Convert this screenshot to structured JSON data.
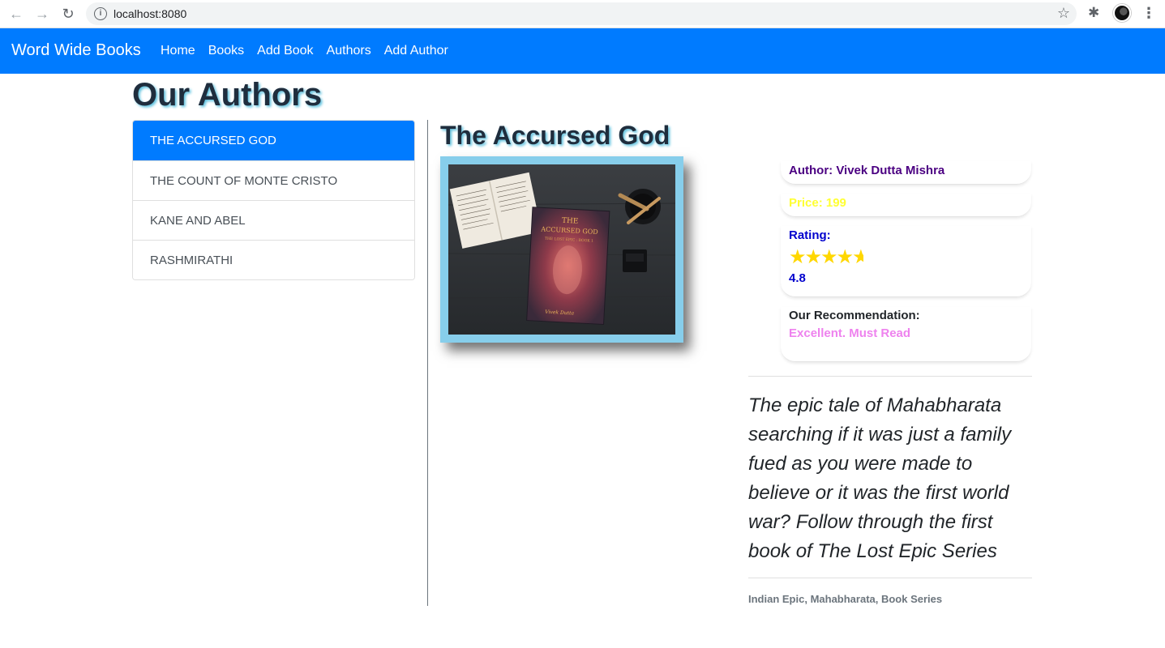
{
  "browser": {
    "url": "localhost:8080",
    "icons": [
      "back-icon",
      "forward-icon",
      "reload-icon",
      "info-icon",
      "star-icon",
      "extensions-icon",
      "profile-avatar",
      "menu-icon"
    ]
  },
  "navbar": {
    "brand": "Word Wide Books",
    "links": [
      "Home",
      "Books",
      "Add Book",
      "Authors",
      "Add Author"
    ],
    "color": "#007bff"
  },
  "page": {
    "title": "Our Authors"
  },
  "book_list": [
    {
      "label": "THE ACCURSED GOD",
      "active": true
    },
    {
      "label": "THE COUNT OF MONTE CRISTO",
      "active": false
    },
    {
      "label": "KANE AND ABEL",
      "active": false
    },
    {
      "label": "RASHMIRATHI",
      "active": false
    }
  ],
  "book": {
    "title": "The Accursed God",
    "author": "Author: Vivek Dutta Mishra",
    "price": "Price: 199",
    "rating_label": "Rating:",
    "rating_value": "4.8",
    "rating": 4.8,
    "rating_max": 5,
    "recommendation_label": "Our Recommendation:",
    "recommendation": "Excellent. Must Read",
    "description": "The epic tale of Mahabharata searching if it was just a family fued as you were made to believe or it was the first world war? Follow through the first book of The Lost Epic Series",
    "tags": "Indian Epic, Mahabharata, Book Series",
    "cover": {
      "title_line1": "THE",
      "title_line2": "ACCURSED GOD",
      "subtitle": "THE LOST EPIC : BOOK 1",
      "author": "Vivek Dutta"
    }
  },
  "colors": {
    "author": "#4b0082",
    "price": "#ffff33",
    "rating": "#0000cd",
    "recommendation": "#ee82ee",
    "stars": "#ffd700",
    "frame": "#87ceeb"
  }
}
